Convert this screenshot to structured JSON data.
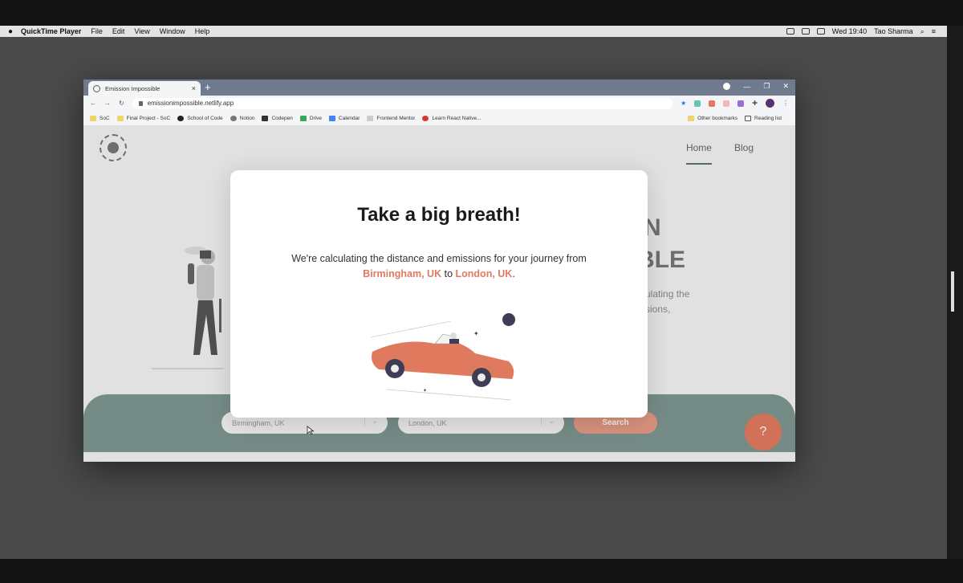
{
  "menubar": {
    "app_name": "QuickTime Player",
    "menus": [
      "File",
      "Edit",
      "View",
      "Window",
      "Help"
    ],
    "clock": "Wed 19:40",
    "user": "Tao Sharma"
  },
  "browser": {
    "tab_title": "Emission Impossible",
    "url": "emissionimpossible.netlify.app",
    "bookmarks": [
      "SoC",
      "Final Project - SoC",
      "School of Code",
      "Notion",
      "Codepen",
      "Drive",
      "Calendar",
      "Frontend Mentor",
      "Learn React Native..."
    ],
    "other_bookmarks": "Other bookmarks",
    "reading_list": "Reading list"
  },
  "site": {
    "nav": [
      "Home",
      "Blog"
    ],
    "hero_title_line1": "N",
    "hero_title_line2": "BLE",
    "hero_text_line1": "ulating the",
    "hero_text_line2": "sions,",
    "search": {
      "from_value": "Birmingham, UK",
      "to_value": "London, UK",
      "button": "Search"
    },
    "help_button": "?"
  },
  "modal": {
    "title": "Take a big breath!",
    "line1": "We're calculating the distance and emissions for your journey from",
    "from": "Birmingham, UK",
    "connector": "to",
    "to": "London, UK",
    "end": "."
  },
  "colors": {
    "accent": "#e07a5f",
    "band": "#7e9691",
    "tabstrip": "#6f7a8e"
  }
}
